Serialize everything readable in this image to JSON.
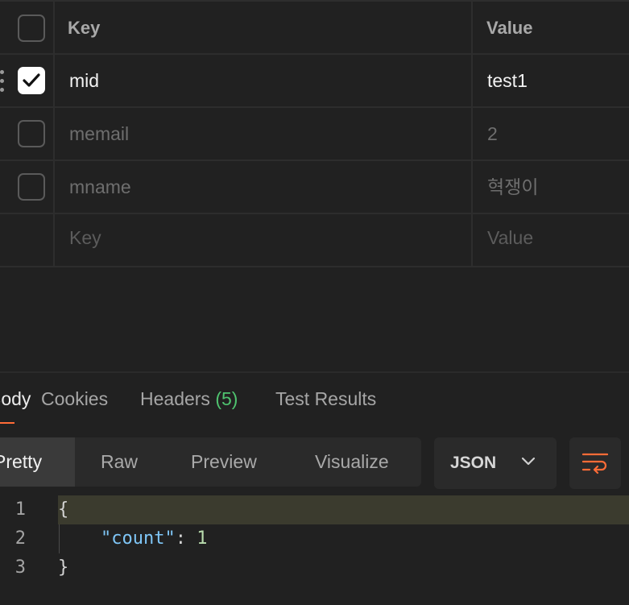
{
  "params": {
    "header": {
      "key": "Key",
      "value": "Value"
    },
    "rows": [
      {
        "key": "mid",
        "value": "test1",
        "checked": true
      },
      {
        "key": "memail",
        "value": "2",
        "checked": false
      },
      {
        "key": "mname",
        "value": "혁쟁이",
        "checked": false
      }
    ],
    "new_row": {
      "key_placeholder": "Key",
      "value_placeholder": "Value"
    }
  },
  "response": {
    "tabs": {
      "body": "Body",
      "cookies": "Cookies",
      "headers": "Headers",
      "headers_count": "(5)",
      "tests": "Test Results"
    },
    "views": {
      "pretty": "Pretty",
      "raw": "Raw",
      "preview": "Preview",
      "visualize": "Visualize"
    },
    "format": "JSON",
    "code": {
      "line_numbers": [
        "1",
        "2",
        "3"
      ],
      "open_brace": "{",
      "key": "\"count\"",
      "colon": ": ",
      "value": "1",
      "close_brace": "}"
    }
  },
  "colors": {
    "accent": "#ff6c37",
    "count_green": "#4fc36f",
    "json_key": "#7fc6f7",
    "json_number": "#b9dcae"
  }
}
